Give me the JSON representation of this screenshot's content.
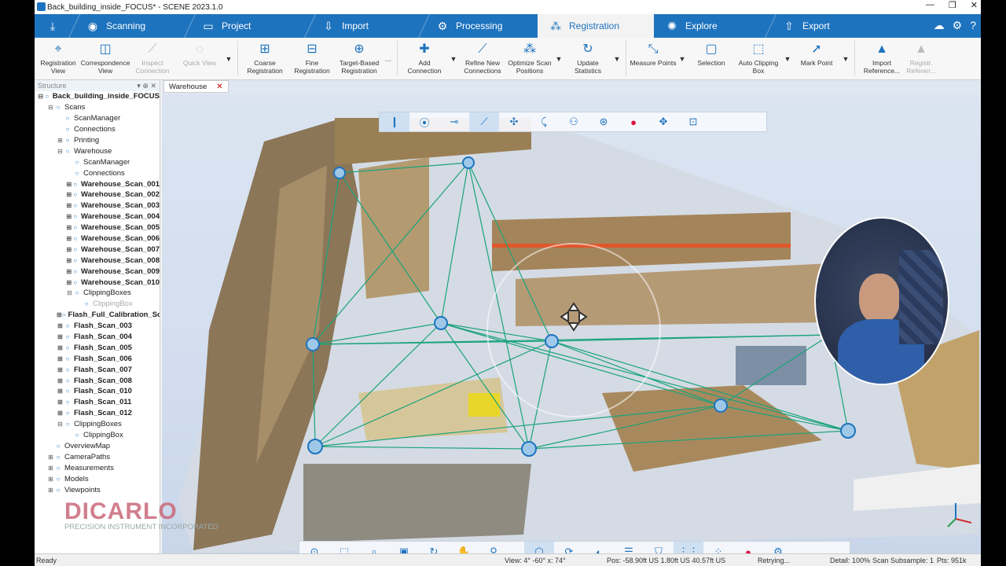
{
  "window": {
    "title": "Back_building_inside_FOCUS* - SCENE 2023.1.0",
    "controls": [
      "—",
      "❐",
      "✕"
    ]
  },
  "tabs": [
    {
      "label": "",
      "icon": "download-icon"
    },
    {
      "label": "Scanning",
      "icon": "scanner-icon"
    },
    {
      "label": "Project",
      "icon": "folder-icon"
    },
    {
      "label": "Import",
      "icon": "import-icon"
    },
    {
      "label": "Processing",
      "icon": "processing-icon"
    },
    {
      "label": "Registration",
      "icon": "registration-icon",
      "active": true
    },
    {
      "label": "Explore",
      "icon": "explore-icon"
    },
    {
      "label": "Export",
      "icon": "export-icon"
    }
  ],
  "ribbon": {
    "items": [
      {
        "label": "Registration View",
        "icon": "registration-view-icon",
        "enabled": true
      },
      {
        "label": "Correspondence View",
        "icon": "correspondence-view-icon",
        "enabled": true
      },
      {
        "label": "Inspect Connection",
        "icon": "inspect-icon",
        "enabled": false
      },
      {
        "label": "Quick View",
        "icon": "quick-view-icon",
        "enabled": false
      },
      {
        "label": "Coarse Registration",
        "icon": "coarse-icon",
        "enabled": true
      },
      {
        "label": "Fine Registration",
        "icon": "fine-icon",
        "enabled": true
      },
      {
        "label": "Target-Based Registration",
        "icon": "target-icon",
        "enabled": true
      },
      {
        "label": "Add Connection",
        "icon": "add-connection-icon",
        "enabled": true
      },
      {
        "label": "Refine New Connections",
        "icon": "refine-icon",
        "enabled": true
      },
      {
        "label": "Optimize Scan Positions",
        "icon": "optimize-icon",
        "enabled": true
      },
      {
        "label": "Update Statistics",
        "icon": "statistics-icon",
        "enabled": true
      },
      {
        "label": "Measure Points",
        "icon": "measure-icon",
        "enabled": true
      },
      {
        "label": "Selection",
        "icon": "selection-icon",
        "enabled": true
      },
      {
        "label": "Auto Clipping Box",
        "icon": "clipping-icon",
        "enabled": true
      },
      {
        "label": "Mark Point",
        "icon": "mark-point-icon",
        "enabled": true
      },
      {
        "label": "Import Reference...",
        "icon": "import-reference-icon",
        "enabled": true
      },
      {
        "label": "Registr. Referen...",
        "icon": "register-reference-icon",
        "enabled": false
      }
    ]
  },
  "structure": {
    "header": "Structure",
    "items": [
      {
        "label": "Back_building_inside_FOCUS",
        "level": 0,
        "toggle": "⊟",
        "bold": true
      },
      {
        "label": "Scans",
        "level": 1,
        "toggle": "⊟"
      },
      {
        "label": "ScanManager",
        "level": 2,
        "toggle": ""
      },
      {
        "label": "Connections",
        "level": 2,
        "toggle": ""
      },
      {
        "label": "Printing",
        "level": 2,
        "toggle": "⊞"
      },
      {
        "label": "Warehouse",
        "level": 2,
        "toggle": "⊟"
      },
      {
        "label": "ScanManager",
        "level": 3,
        "toggle": ""
      },
      {
        "label": "Connections",
        "level": 3,
        "toggle": ""
      },
      {
        "label": "Warehouse_Scan_001",
        "level": 3,
        "toggle": "⊞",
        "bold": true
      },
      {
        "label": "Warehouse_Scan_002",
        "level": 3,
        "toggle": "⊞",
        "bold": true
      },
      {
        "label": "Warehouse_Scan_003",
        "level": 3,
        "toggle": "⊞",
        "bold": true
      },
      {
        "label": "Warehouse_Scan_004",
        "level": 3,
        "toggle": "⊞",
        "bold": true
      },
      {
        "label": "Warehouse_Scan_005",
        "level": 3,
        "toggle": "⊞",
        "bold": true
      },
      {
        "label": "Warehouse_Scan_006",
        "level": 3,
        "toggle": "⊞",
        "bold": true
      },
      {
        "label": "Warehouse_Scan_007",
        "level": 3,
        "toggle": "⊞",
        "bold": true
      },
      {
        "label": "Warehouse_Scan_008",
        "level": 3,
        "toggle": "⊞",
        "bold": true
      },
      {
        "label": "Warehouse_Scan_009",
        "level": 3,
        "toggle": "⊞",
        "bold": true
      },
      {
        "label": "Warehouse_Scan_010",
        "level": 3,
        "toggle": "⊞",
        "bold": true
      },
      {
        "label": "ClippingBoxes",
        "level": 3,
        "toggle": "⊟"
      },
      {
        "label": "ClippingBox",
        "level": 4,
        "toggle": "",
        "dim": true
      },
      {
        "label": "Flash_Full_Calibration_Scan",
        "level": 2,
        "toggle": "⊞",
        "bold": true
      },
      {
        "label": "Flash_Scan_003",
        "level": 2,
        "toggle": "⊞",
        "bold": true
      },
      {
        "label": "Flash_Scan_004",
        "level": 2,
        "toggle": "⊞",
        "bold": true
      },
      {
        "label": "Flash_Scan_005",
        "level": 2,
        "toggle": "⊞",
        "bold": true
      },
      {
        "label": "Flash_Scan_006",
        "level": 2,
        "toggle": "⊞",
        "bold": true
      },
      {
        "label": "Flash_Scan_007",
        "level": 2,
        "toggle": "⊞",
        "bold": true
      },
      {
        "label": "Flash_Scan_008",
        "level": 2,
        "toggle": "⊞",
        "bold": true
      },
      {
        "label": "Flash_Scan_010",
        "level": 2,
        "toggle": "⊞",
        "bold": true
      },
      {
        "label": "Flash_Scan_011",
        "level": 2,
        "toggle": "⊞",
        "bold": true
      },
      {
        "label": "Flash_Scan_012",
        "level": 2,
        "toggle": "⊞",
        "bold": true
      },
      {
        "label": "ClippingBoxes",
        "level": 2,
        "toggle": "⊟"
      },
      {
        "label": "ClippingBox",
        "level": 3,
        "toggle": ""
      },
      {
        "label": "OverviewMap",
        "level": 1,
        "toggle": ""
      },
      {
        "label": "CameraPaths",
        "level": 1,
        "toggle": "⊞"
      },
      {
        "label": "Measurements",
        "level": 1,
        "toggle": "⊞"
      },
      {
        "label": "Models",
        "level": 1,
        "toggle": "⊞"
      },
      {
        "label": "Viewpoints",
        "level": 1,
        "toggle": "⊞"
      }
    ]
  },
  "watermark": {
    "brand": "DICARLO",
    "subtitle": "PRECISION INSTRUMENT INCORPORATED"
  },
  "viewport": {
    "tab_label": "Warehouse",
    "accent_color": "#1e73be",
    "connection_color": "#1aa37a"
  },
  "statusbar": {
    "left": "Ready",
    "view": "View: 4° -60° x: 74°",
    "pos": "Pos: -58.90ft US 1.80ft US 40.57ft US",
    "state": "Retrying...",
    "detail": "Detail: 100%",
    "subsample": "Scan Subsample: 1",
    "pts": "Pts: 951k"
  }
}
